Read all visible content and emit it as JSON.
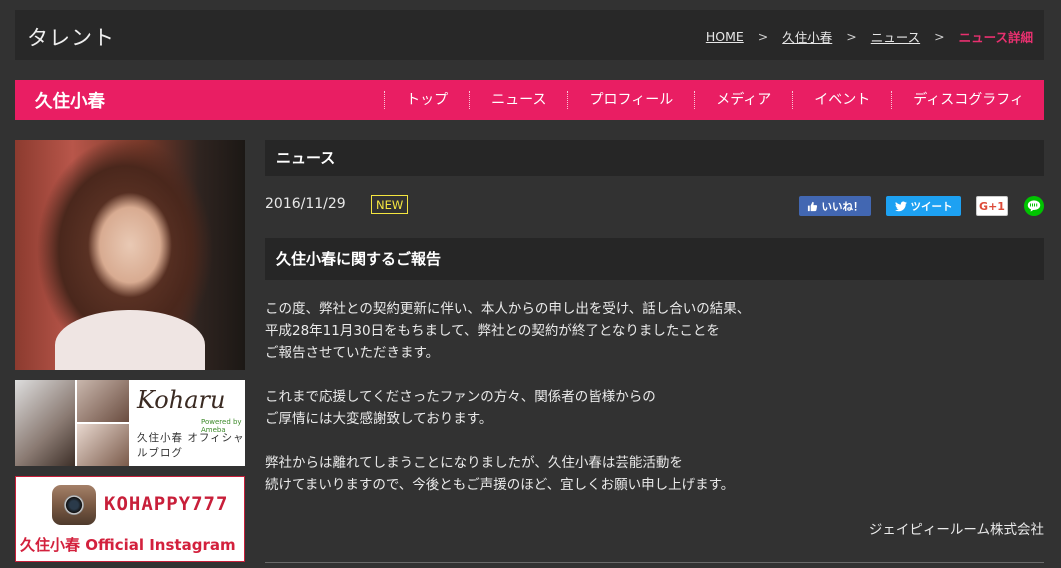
{
  "header": {
    "section_title": "タレント",
    "breadcrumb": [
      {
        "label": "HOME"
      },
      {
        "label": "久住小春"
      },
      {
        "label": "ニュース"
      }
    ],
    "breadcrumb_separator": ">",
    "breadcrumb_current": "ニュース詳細"
  },
  "talent": {
    "name": "久住小春",
    "nav": [
      "トップ",
      "ニュース",
      "プロフィール",
      "メディア",
      "イベント",
      "ディスコグラフィ"
    ]
  },
  "sidebar": {
    "blog_banner": {
      "logo": "Koharu",
      "powered": "Powered by Ameba",
      "subtitle": "久住小春 オフィシャルブログ"
    },
    "instagram_banner": {
      "handle": "KOHAPPY777",
      "caption": "久住小春 Official Instagram"
    }
  },
  "main": {
    "header": "ニュース",
    "date": "2016/11/29",
    "badge": "NEW",
    "social": {
      "like": "いいね！",
      "tweet": "ツイート",
      "gplus": "G+1"
    },
    "article_title": "久住小春に関するご報告",
    "paragraphs": [
      [
        "この度、弊社との契約更新に伴い、本人からの申し出を受け、話し合いの結果、",
        "平成28年11月30日をもちまして、弊社との契約が終了となりましたことを",
        "ご報告させていただきます。"
      ],
      [
        "これまで応援してくださったファンの方々、関係者の皆様からの",
        "ご厚情には大変感謝致しております。"
      ],
      [
        "弊社からは離れてしまうことになりましたが、久住小春は芸能活動を",
        "続けてまいりますので、今後ともご声援のほど、宜しくお願い申し上げます。"
      ]
    ],
    "signature": "ジェイピィールーム株式会社"
  },
  "colors": {
    "accent": "#e91e63",
    "background": "#323232",
    "header_bg": "#282828",
    "new_badge": "#f5e640"
  }
}
